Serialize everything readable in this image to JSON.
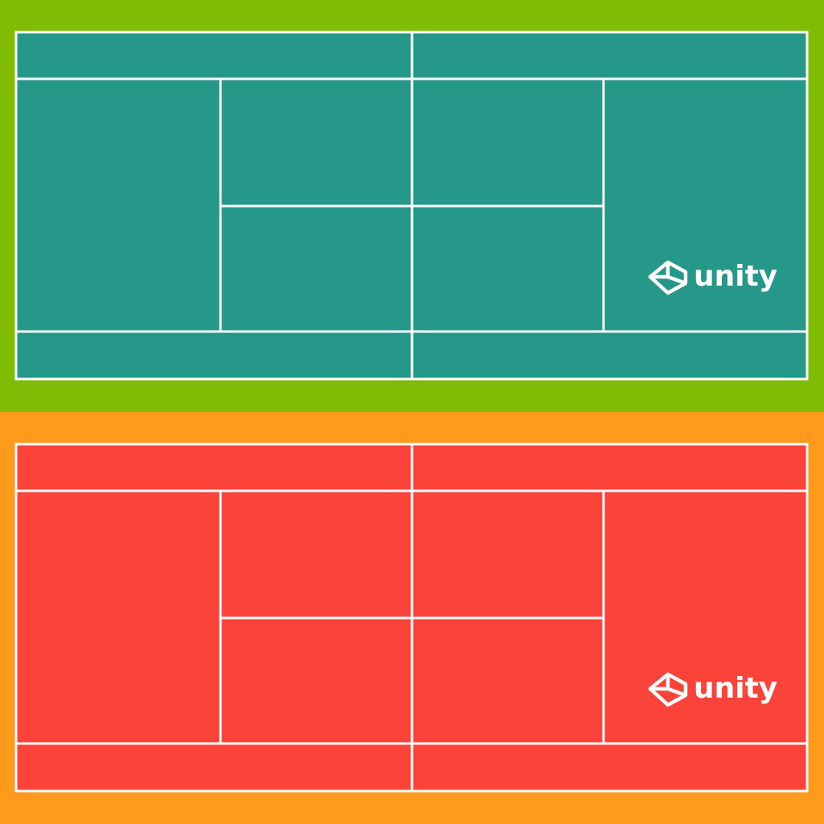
{
  "courts": [
    {
      "id": "court-green",
      "colors": {
        "surround": "#80BC04",
        "surface": "#26988A",
        "lines": "#FFFFFF"
      },
      "logo": {
        "icon": "unity-cube-icon",
        "text": "unity"
      }
    },
    {
      "id": "court-red",
      "colors": {
        "surround": "#FF9A1C",
        "surface": "#FC433A",
        "lines": "#FFFFFF"
      },
      "logo": {
        "icon": "unity-cube-icon",
        "text": "unity"
      }
    }
  ]
}
